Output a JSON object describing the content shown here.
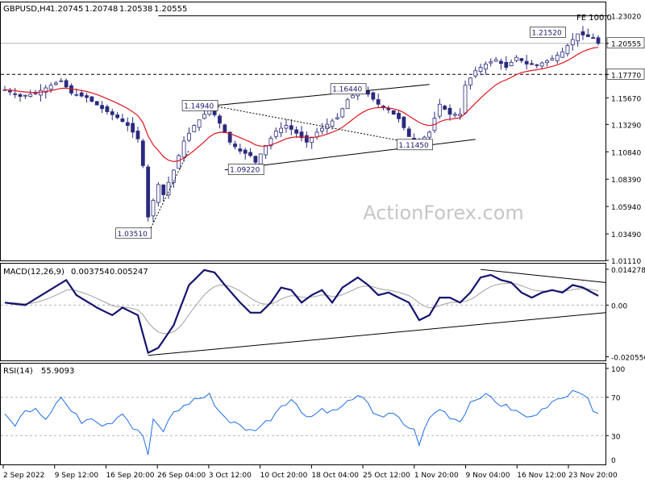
{
  "chart_data": [
    {
      "panel": "price",
      "type": "candlestick",
      "header": {
        "symbol": "GBPUSD,H4",
        "open": "1.20745",
        "high": "1.20748",
        "low": "1.20538",
        "close": "1.20555"
      },
      "watermark": "ActionForex.com",
      "y_ticks": [
        "1.23020",
        "1.20555",
        "1.17770",
        "1.15670",
        "1.13290",
        "1.10840",
        "1.08390",
        "1.05940",
        "1.03490",
        "1.01110"
      ],
      "ylim": [
        1.0111,
        1.2422
      ],
      "current_price": "1.20555",
      "fe_line": {
        "label": "FE 100.0",
        "value": 1.2302
      },
      "support_level": {
        "label": "1.17770",
        "value": 1.1777
      },
      "close_path": [
        [
          0,
          1.164
        ],
        [
          3,
          1.158
        ],
        [
          6,
          1.161
        ],
        [
          9,
          1.168
        ],
        [
          11,
          1.172
        ],
        [
          13,
          1.161
        ],
        [
          16,
          1.157
        ],
        [
          19,
          1.147
        ],
        [
          22,
          1.139
        ],
        [
          24,
          1.132
        ],
        [
          26,
          1.12
        ],
        [
          27,
          1.096
        ],
        [
          28,
          1.05
        ],
        [
          29,
          1.065
        ],
        [
          30,
          1.079
        ],
        [
          31,
          1.07
        ],
        [
          33,
          1.092
        ],
        [
          35,
          1.118
        ],
        [
          37,
          1.132
        ],
        [
          39,
          1.142
        ],
        [
          40,
          1.149
        ],
        [
          42,
          1.134
        ],
        [
          44,
          1.117
        ],
        [
          46,
          1.109
        ],
        [
          48,
          1.105
        ],
        [
          49,
          1.099
        ],
        [
          51,
          1.114
        ],
        [
          53,
          1.127
        ],
        [
          55,
          1.132
        ],
        [
          57,
          1.125
        ],
        [
          59,
          1.117
        ],
        [
          61,
          1.126
        ],
        [
          63,
          1.133
        ],
        [
          65,
          1.139
        ],
        [
          67,
          1.155
        ],
        [
          69,
          1.163
        ],
        [
          71,
          1.16
        ],
        [
          73,
          1.151
        ],
        [
          75,
          1.146
        ],
        [
          77,
          1.138
        ],
        [
          79,
          1.122
        ],
        [
          81,
          1.117
        ],
        [
          83,
          1.126
        ],
        [
          85,
          1.151
        ],
        [
          87,
          1.142
        ],
        [
          89,
          1.142
        ],
        [
          90,
          1.168
        ],
        [
          92,
          1.181
        ],
        [
          94,
          1.187
        ],
        [
          96,
          1.191
        ],
        [
          98,
          1.184
        ],
        [
          100,
          1.193
        ],
        [
          102,
          1.187
        ],
        [
          104,
          1.186
        ],
        [
          106,
          1.19
        ],
        [
          107,
          1.192
        ],
        [
          109,
          1.198
        ],
        [
          111,
          1.209
        ],
        [
          112,
          1.214
        ],
        [
          113,
          1.213
        ],
        [
          115,
          1.21
        ],
        [
          116,
          1.2055
        ]
      ],
      "annotations": [
        {
          "label": "1.03510",
          "value": 1.0351
        },
        {
          "label": "1.14940",
          "value": 1.1494
        },
        {
          "label": "1.09220",
          "value": 1.0922
        },
        {
          "label": "1.16440",
          "value": 1.1644
        },
        {
          "label": "1.11450",
          "value": 1.1145
        },
        {
          "label": "1.21520",
          "value": 1.2152
        }
      ],
      "colors": {
        "candle": "#2a2a7e",
        "ma": "#e0141e",
        "trend": "#000000"
      }
    },
    {
      "panel": "macd",
      "type": "line",
      "header": {
        "name": "MACD(12,26,9)",
        "macd": "0.003754",
        "signal": "0.005247"
      },
      "y_ticks": [
        "0.014278",
        "0.00",
        "-0.020556"
      ],
      "ylim": [
        -0.022,
        0.0165
      ],
      "macd_path": [
        [
          0,
          0.001
        ],
        [
          4,
          0.0
        ],
        [
          8,
          0.005
        ],
        [
          12,
          0.01
        ],
        [
          14,
          0.004
        ],
        [
          18,
          -0.001
        ],
        [
          21,
          -0.004
        ],
        [
          23,
          -0.001
        ],
        [
          26,
          -0.004
        ],
        [
          28,
          -0.019
        ],
        [
          30,
          -0.017
        ],
        [
          33,
          -0.008
        ],
        [
          36,
          0.008
        ],
        [
          39,
          0.014
        ],
        [
          41,
          0.013
        ],
        [
          43,
          0.008
        ],
        [
          46,
          0.001
        ],
        [
          48,
          -0.003
        ],
        [
          50,
          -0.003
        ],
        [
          52,
          0.001
        ],
        [
          54,
          0.007
        ],
        [
          56,
          0.006
        ],
        [
          58,
          0.001
        ],
        [
          60,
          0.004
        ],
        [
          62,
          0.006
        ],
        [
          64,
          0.001
        ],
        [
          66,
          0.007
        ],
        [
          69,
          0.011
        ],
        [
          71,
          0.008
        ],
        [
          73,
          0.004
        ],
        [
          75,
          0.005
        ],
        [
          77,
          0.003
        ],
        [
          79,
          0.001
        ],
        [
          81,
          -0.006
        ],
        [
          83,
          -0.004
        ],
        [
          85,
          0.003
        ],
        [
          87,
          0.003
        ],
        [
          89,
          0.001
        ],
        [
          91,
          0.005
        ],
        [
          93,
          0.011
        ],
        [
          95,
          0.012
        ],
        [
          97,
          0.01
        ],
        [
          99,
          0.009
        ],
        [
          101,
          0.005
        ],
        [
          103,
          0.003
        ],
        [
          105,
          0.005
        ],
        [
          107,
          0.006
        ],
        [
          109,
          0.005
        ],
        [
          111,
          0.008
        ],
        [
          113,
          0.007
        ],
        [
          116,
          0.0037
        ]
      ],
      "colors": {
        "macd": "#14146e",
        "signal": "#a0a0a0"
      }
    },
    {
      "panel": "rsi",
      "type": "line",
      "header": {
        "name": "RSI(14)",
        "value": "55.9093"
      },
      "y_ticks": [
        "100",
        "70",
        "30",
        "0"
      ],
      "ylim": [
        0,
        100
      ],
      "levels": [
        70,
        30
      ],
      "rsi_path": [
        [
          0,
          50
        ],
        [
          2,
          42
        ],
        [
          4,
          55
        ],
        [
          6,
          60
        ],
        [
          8,
          48
        ],
        [
          10,
          65
        ],
        [
          11,
          70
        ],
        [
          13,
          55
        ],
        [
          15,
          45
        ],
        [
          17,
          50
        ],
        [
          19,
          42
        ],
        [
          21,
          45
        ],
        [
          23,
          55
        ],
        [
          25,
          38
        ],
        [
          27,
          30
        ],
        [
          28,
          10
        ],
        [
          29,
          45
        ],
        [
          31,
          35
        ],
        [
          33,
          55
        ],
        [
          35,
          60
        ],
        [
          37,
          68
        ],
        [
          39,
          70
        ],
        [
          40,
          72
        ],
        [
          42,
          55
        ],
        [
          44,
          45
        ],
        [
          46,
          40
        ],
        [
          48,
          35
        ],
        [
          50,
          40
        ],
        [
          52,
          48
        ],
        [
          54,
          62
        ],
        [
          56,
          68
        ],
        [
          58,
          55
        ],
        [
          60,
          50
        ],
        [
          62,
          58
        ],
        [
          64,
          55
        ],
        [
          66,
          60
        ],
        [
          68,
          70
        ],
        [
          70,
          68
        ],
        [
          72,
          55
        ],
        [
          74,
          50
        ],
        [
          76,
          52
        ],
        [
          78,
          42
        ],
        [
          80,
          35
        ],
        [
          81,
          22
        ],
        [
          83,
          48
        ],
        [
          85,
          58
        ],
        [
          87,
          50
        ],
        [
          89,
          45
        ],
        [
          91,
          65
        ],
        [
          93,
          72
        ],
        [
          95,
          70
        ],
        [
          97,
          62
        ],
        [
          99,
          58
        ],
        [
          101,
          52
        ],
        [
          103,
          48
        ],
        [
          105,
          60
        ],
        [
          107,
          64
        ],
        [
          109,
          68
        ],
        [
          111,
          80
        ],
        [
          113,
          74
        ],
        [
          115,
          58
        ],
        [
          116,
          56
        ]
      ],
      "colors": {
        "rsi": "#1e6ee6"
      }
    }
  ],
  "x_axis_labels": [
    "2 Sep 2022",
    "9 Sep 12:00",
    "16 Sep 20:00",
    "26 Sep 04:00",
    "3 Oct 12:00",
    "10 Oct 20:00",
    "18 Oct 04:00",
    "25 Oct 12:00",
    "1 Nov 20:00",
    "9 Nov 04:00",
    "16 Nov 12:00",
    "23 Nov 20:00"
  ]
}
